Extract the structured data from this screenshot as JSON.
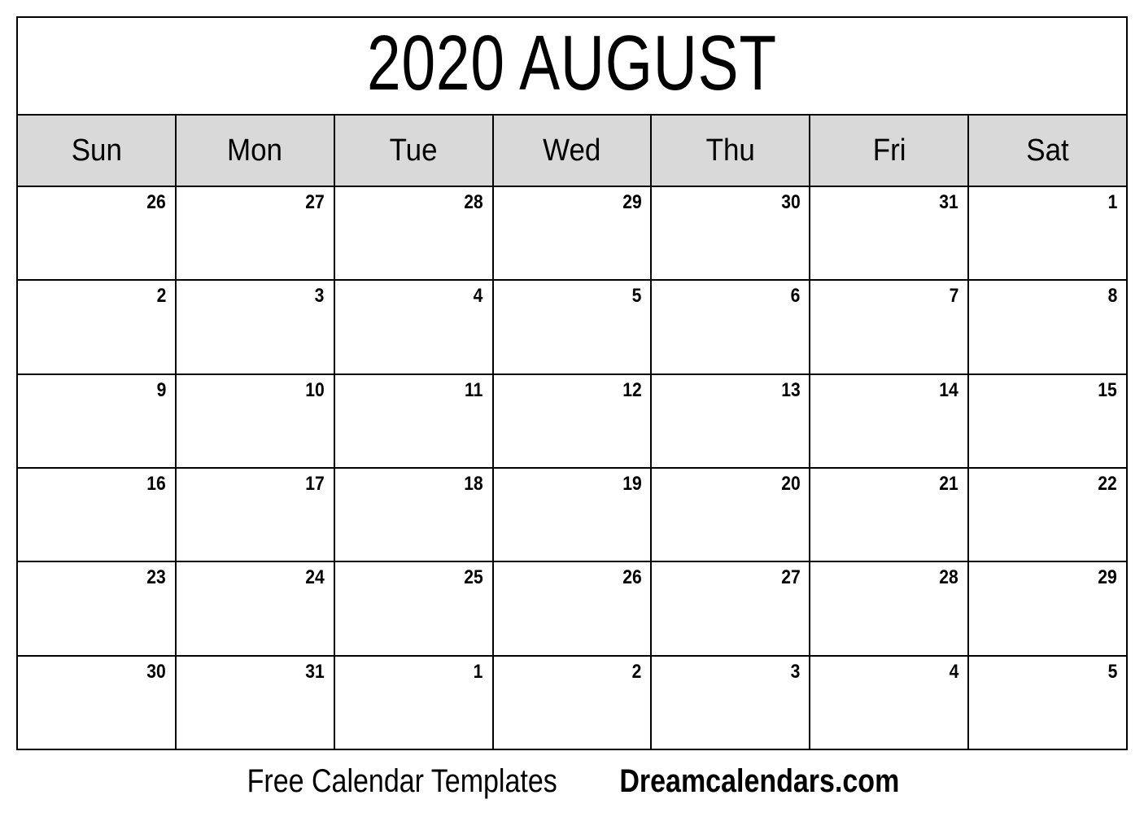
{
  "page": {
    "background_color": "#ffffff",
    "text_color": "#000000",
    "border_color": "#000000",
    "header_background_color": "#d9d9d9"
  },
  "calendar": {
    "title": "2020 AUGUST",
    "year": "2020",
    "month": "AUGUST",
    "weekday_headers": [
      {
        "label": "Sun"
      },
      {
        "label": "Mon"
      },
      {
        "label": "Tue"
      },
      {
        "label": "Wed"
      },
      {
        "label": "Thu"
      },
      {
        "label": "Fri"
      },
      {
        "label": "Sat"
      }
    ],
    "weeks": [
      {
        "days": [
          {
            "number": "26",
            "in_month": false
          },
          {
            "number": "27",
            "in_month": false
          },
          {
            "number": "28",
            "in_month": false
          },
          {
            "number": "29",
            "in_month": false
          },
          {
            "number": "30",
            "in_month": false
          },
          {
            "number": "31",
            "in_month": false
          },
          {
            "number": "1",
            "in_month": true
          }
        ]
      },
      {
        "days": [
          {
            "number": "2",
            "in_month": true
          },
          {
            "number": "3",
            "in_month": true
          },
          {
            "number": "4",
            "in_month": true
          },
          {
            "number": "5",
            "in_month": true
          },
          {
            "number": "6",
            "in_month": true
          },
          {
            "number": "7",
            "in_month": true
          },
          {
            "number": "8",
            "in_month": true
          }
        ]
      },
      {
        "days": [
          {
            "number": "9",
            "in_month": true
          },
          {
            "number": "10",
            "in_month": true
          },
          {
            "number": "11",
            "in_month": true
          },
          {
            "number": "12",
            "in_month": true
          },
          {
            "number": "13",
            "in_month": true
          },
          {
            "number": "14",
            "in_month": true
          },
          {
            "number": "15",
            "in_month": true
          }
        ]
      },
      {
        "days": [
          {
            "number": "16",
            "in_month": true
          },
          {
            "number": "17",
            "in_month": true
          },
          {
            "number": "18",
            "in_month": true
          },
          {
            "number": "19",
            "in_month": true
          },
          {
            "number": "20",
            "in_month": true
          },
          {
            "number": "21",
            "in_month": true
          },
          {
            "number": "22",
            "in_month": true
          }
        ]
      },
      {
        "days": [
          {
            "number": "23",
            "in_month": true
          },
          {
            "number": "24",
            "in_month": true
          },
          {
            "number": "25",
            "in_month": true
          },
          {
            "number": "26",
            "in_month": true
          },
          {
            "number": "27",
            "in_month": true
          },
          {
            "number": "28",
            "in_month": true
          },
          {
            "number": "29",
            "in_month": true
          }
        ]
      },
      {
        "days": [
          {
            "number": "30",
            "in_month": true
          },
          {
            "number": "31",
            "in_month": true
          },
          {
            "number": "1",
            "in_month": false
          },
          {
            "number": "2",
            "in_month": false
          },
          {
            "number": "3",
            "in_month": false
          },
          {
            "number": "4",
            "in_month": false
          },
          {
            "number": "5",
            "in_month": false
          }
        ]
      }
    ]
  },
  "footer": {
    "tagline": "Free Calendar Templates",
    "brand": "Dreamcalendars.com"
  }
}
